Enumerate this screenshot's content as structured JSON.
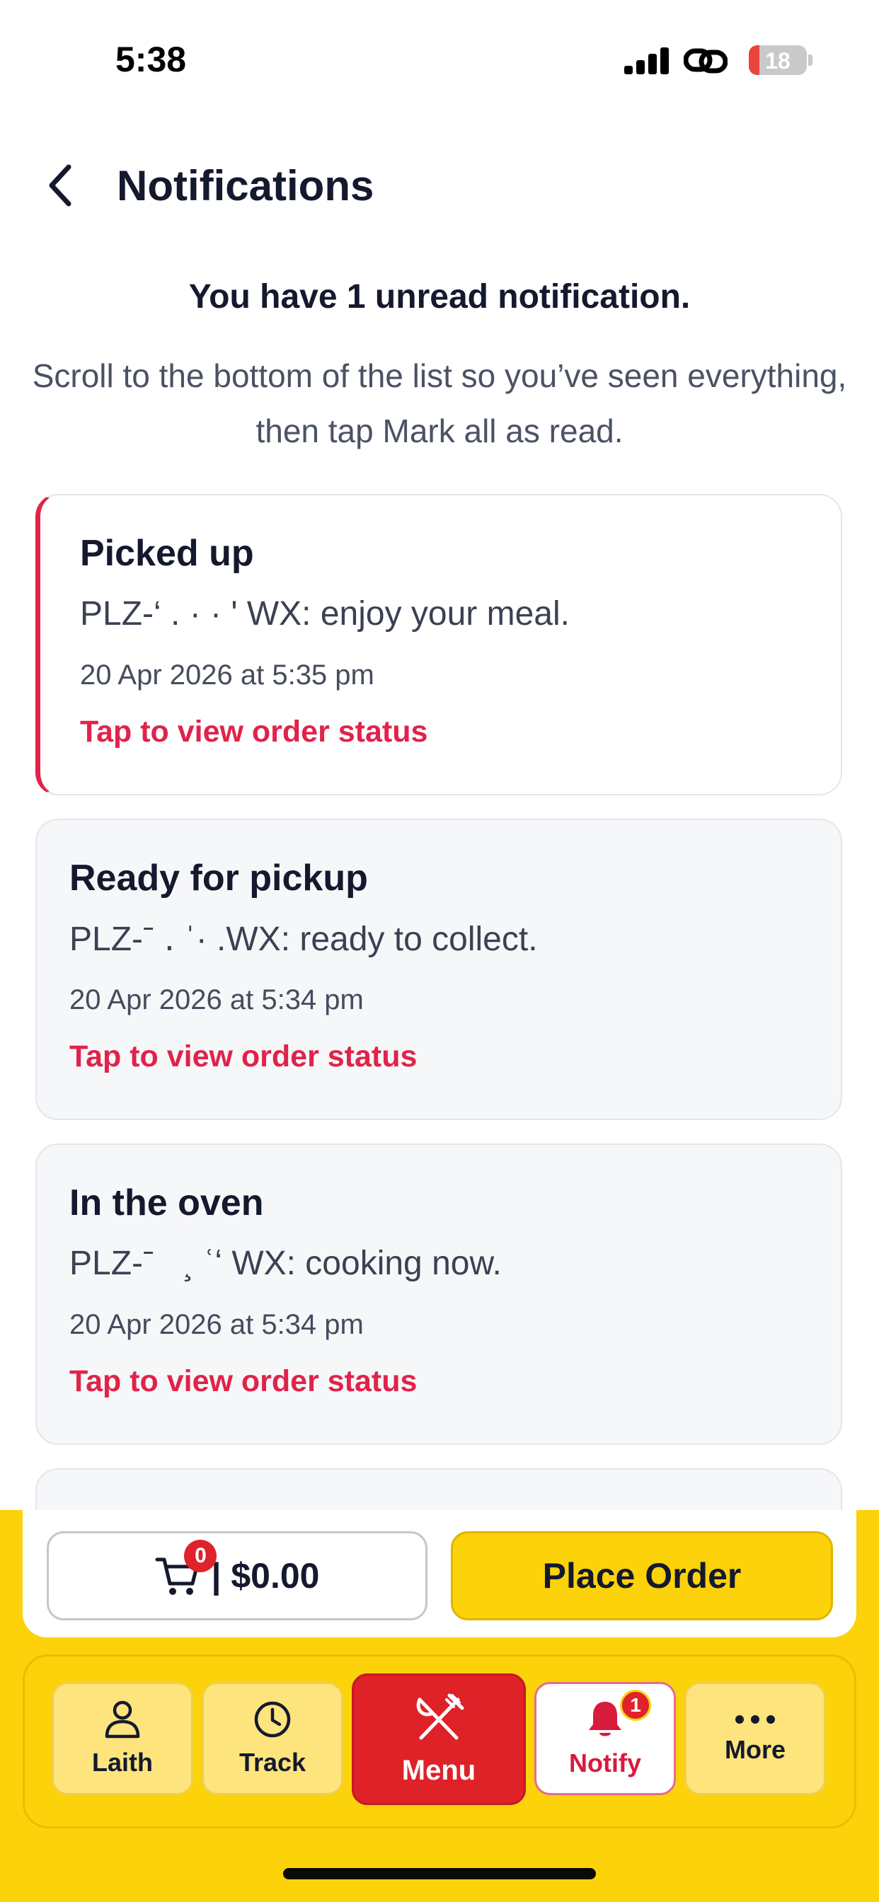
{
  "status_bar": {
    "time": "5:38",
    "battery": "18",
    "battery_level": 0.18
  },
  "header": {
    "title": "Notifications"
  },
  "summary": {
    "unread_text": "You have 1 unread notification.",
    "hint_text": "Scroll to the bottom of the list so you’ve seen everything, then tap Mark all as read."
  },
  "notifications": [
    {
      "title": "Picked up",
      "body": "PLZ-‘ . · · ' WX: enjoy your meal.",
      "time": "20 Apr 2026 at 5:35 pm",
      "link": "Tap to view order status",
      "unread": true
    },
    {
      "title": "Ready for pickup",
      "body": "PLZ-ˉ ․ ˈ· .WX: ready to collect.",
      "time": "20 Apr 2026 at 5:34 pm",
      "link": "Tap to view order status",
      "unread": false
    },
    {
      "title": "In the oven",
      "body": "PLZ-ˉ   ¸ ʿʻ WX: cooking now.",
      "time": "20 Apr 2026 at 5:34 pm",
      "link": "Tap to view order status",
      "unread": false
    }
  ],
  "order_bar": {
    "cart_count": "0",
    "cart_total": "| $0.00",
    "place_order_label": "Place Order"
  },
  "nav": {
    "profile_label": "Laith",
    "track_label": "Track",
    "menu_label": "Menu",
    "notify_label": "Notify",
    "notify_badge": "1",
    "more_label": "More"
  },
  "colors": {
    "brand_yellow": "#fcd20a",
    "brand_red": "#df2128",
    "accent_pink": "#e0234a"
  }
}
